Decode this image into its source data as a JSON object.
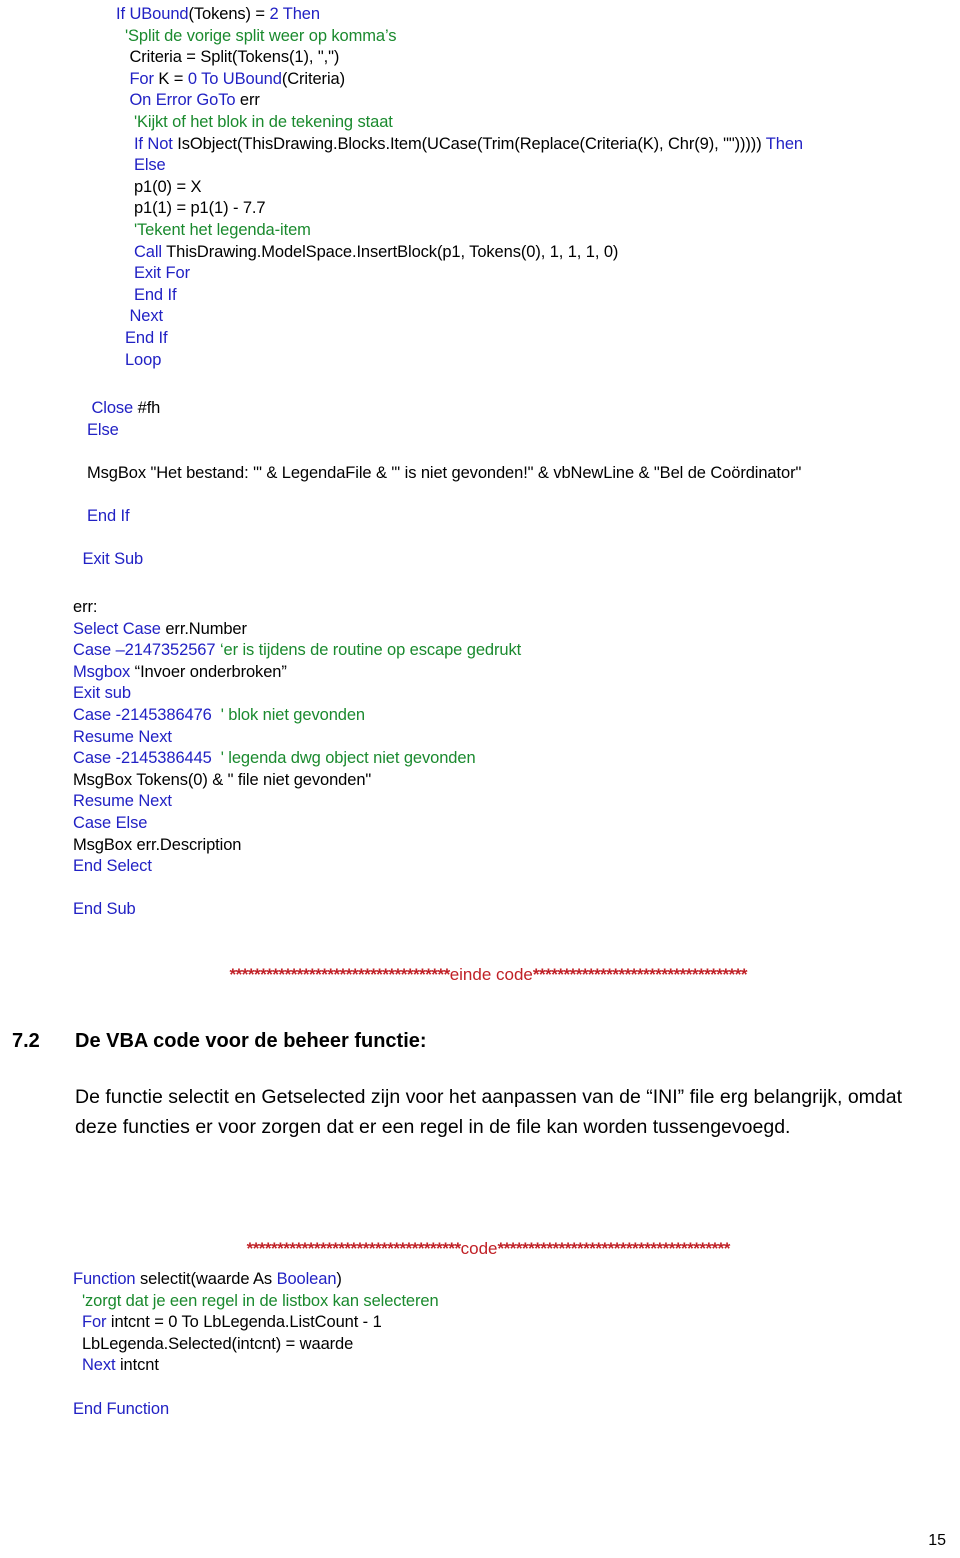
{
  "document": {
    "page_number": "15",
    "colors": {
      "keyword": "#2121c4",
      "comment": "#1a8a2e",
      "plain": "#000000",
      "separator": "#c02026",
      "background": "#ffffff"
    }
  },
  "code_block_1": {
    "lines": [
      "<span class=\"kw\">If </span><span class=\"kw\">UBound</span><span class=\"plain\">(Tokens) = </span><span class=\"kw\">2 Then</span>",
      "  <span class=\"cmt\">'Split de vorige split weer op komma’s</span>",
      "   <span class=\"plain\">Criteria = Split(Tokens(1), \",\")</span>",
      "   <span class=\"kw\">For </span><span class=\"plain\">K = </span><span class=\"kw\">0 To UBound</span><span class=\"plain\">(Criteria)</span>",
      "   <span class=\"kw\">On Error GoTo </span><span class=\"plain\">err</span>",
      "    <span class=\"cmt\">'Kijkt of het blok in de tekening staat</span>",
      "    <span class=\"kw\">If Not </span><span class=\"plain\">IsObject(ThisDrawing.Blocks.Item(UCase(Trim(Replace(Criteria(K), Chr(9), \"\")))))</span><span class=\"kw\"> Then</span>",
      "    <span class=\"kw\">Else</span>",
      "    <span class=\"plain\">p1(0) = X</span>",
      "    <span class=\"plain\">p1(1) = p1(1) - 7.7</span>",
      "    <span class=\"cmt\">'Tekent het legenda-item</span>",
      "    <span class=\"kw\">Call </span><span class=\"plain\">ThisDrawing.ModelSpace.InsertBlock(p1, Tokens(0), 1, 1, 1, 0)</span>",
      "    <span class=\"kw\">Exit For</span>",
      "    <span class=\"kw\">End If</span>",
      "   <span class=\"kw\">Next</span>",
      "  <span class=\"kw\">End If</span>",
      "  <span class=\"kw\">Loop</span>"
    ],
    "plain_text": [
      "If UBound(Tokens) = 2 Then",
      "'Split de vorige split weer op komma’s",
      "Criteria = Split(Tokens(1), \",\")",
      "For K = 0 To UBound(Criteria)",
      "On Error GoTo err",
      "'Kijkt of het blok in de tekening staat",
      "If Not IsObject(ThisDrawing.Blocks.Item(UCase(Trim(Replace(Criteria(K), Chr(9), \"\")))))  Then",
      "Else",
      "p1(0) = X",
      "p1(1) = p1(1) - 7.7",
      "'Tekent het legenda-item",
      "Call ThisDrawing.ModelSpace.InsertBlock(p1, Tokens(0), 1, 1, 1, 0)",
      "Exit For",
      "End If",
      "Next",
      "End If",
      "Loop"
    ]
  },
  "code_block_2": {
    "lines": [
      "   <span class=\"kw\">Close </span><span class=\"plain\">#fh</span>",
      "  <span class=\"kw\">Else</span>",
      "",
      "  <span class=\"plain\">MsgBox \"Het bestand: '\" &amp; LegendaFile &amp; \"' is niet gevonden!\" &amp; vbNewLine &amp; \"Bel de Coördinator\"</span>",
      "",
      "  <span class=\"kw\">End If</span>",
      "",
      " <span class=\"kw\">Exit Sub</span>"
    ],
    "plain_text": [
      "Close #fh",
      "Else",
      "MsgBox \"Het bestand: '\" & LegendaFile & \"' is niet gevonden!\" & vbNewLine & \"Bel de Coördinator\"",
      "End If",
      "Exit Sub"
    ]
  },
  "code_block_3": {
    "lines": [
      "<span class=\"plain\">err:</span>",
      "<span class=\"kw\">Select Case </span><span class=\"plain\">err.Number</span>",
      "<span class=\"kw\">Case –2147352567 </span><span class=\"cmt\">‘er is tijdens de routine op escape gedrukt</span>",
      "<span class=\"kw\">Msgbox </span><span class=\"plain\">“Invoer onderbroken”</span>",
      "<span class=\"kw\">Exit sub</span>",
      "<span class=\"kw\">Case -2145386476 </span><span class=\"cmt\"> ' blok niet gevonden</span>",
      "<span class=\"kw\">Resume Next</span>",
      "<span class=\"kw\">Case -2145386445 </span><span class=\"cmt\"> ' legenda dwg object niet gevonden</span>",
      "<span class=\"plain\">MsgBox Tokens(0) &amp; \" file niet gevonden\"</span>",
      "<span class=\"kw\">Resume Next</span>",
      "<span class=\"kw\">Case Else</span>",
      "<span class=\"plain\">MsgBox err.Description</span>",
      "<span class=\"kw\">End Select</span>",
      "",
      "<span class=\"kw\">End Sub</span>"
    ],
    "plain_text": [
      "err:",
      "Select Case err.Number",
      "Case –2147352567 ‘er is tijdens de routine op escape gedrukt",
      "Msgbox “Invoer onderbroken”",
      "Exit sub",
      "Case -2145386476  ' blok niet gevonden",
      "Resume Next",
      "Case -2145386445  ' legenda dwg object niet gevonden",
      "MsgBox Tokens(0) & \" file niet gevonden\"",
      "Resume Next",
      "Case Else",
      "MsgBox err.Description",
      "End Select",
      "End Sub"
    ]
  },
  "separator_end_code": {
    "stars_before": "************************************",
    "word": "einde code",
    "stars_after": "***********************************"
  },
  "separator_code": {
    "stars_before": "***********************************",
    "word": "code",
    "stars_after": "**************************************"
  },
  "section": {
    "number": "7.2",
    "title": "De VBA code voor de beheer functie:",
    "paragraph": "De functie selectit en Getselected zijn voor het aanpassen van de “INI” file erg belangrijk, omdat deze functies er voor zorgen dat er een regel in de file kan worden tussengevoegd."
  },
  "code_block_4": {
    "lines": [
      "<span class=\"kw\">Function </span><span class=\"plain\">selectit(waarde As </span><span class=\"kw\">Boolean</span><span class=\"plain\">)</span>",
      "  <span class=\"cmt\">'zorgt dat je een regel in de listbox kan selecteren</span>",
      "  <span class=\"kw\">For </span><span class=\"plain\">intcnt = 0 To LbLegenda.ListCount - 1</span>",
      "  <span class=\"plain\">LbLegenda.Selected(intcnt) = waarde</span>",
      "  <span class=\"kw\">Next </span><span class=\"plain\">intcnt</span>",
      "",
      "<span class=\"kw\">End Function</span>"
    ],
    "plain_text": [
      "Function selectit(waarde As Boolean)",
      "'zorgt dat je een regel in de listbox kan selecteren",
      "For intcnt = 0 To LbLegenda.ListCount - 1",
      "LbLegenda.Selected(intcnt) = waarde",
      "Next intcnt",
      "End Function"
    ]
  }
}
